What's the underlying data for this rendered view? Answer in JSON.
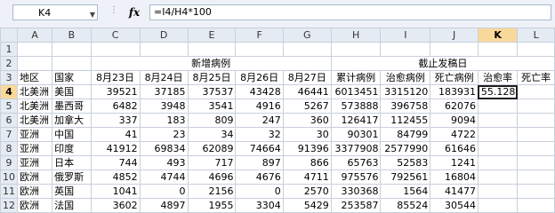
{
  "formula_bar": {
    "name_box": "K4",
    "fx_label": "fx",
    "formula": "=I4/H4*100"
  },
  "columns": [
    "A",
    "B",
    "C",
    "D",
    "E",
    "F",
    "G",
    "H",
    "I",
    "J",
    "K",
    "L"
  ],
  "rows": [
    "1",
    "2",
    "3",
    "4",
    "5",
    "6",
    "7",
    "8",
    "9",
    "10",
    "11",
    "12"
  ],
  "headers": {
    "new_cases": "新增病例",
    "as_of": "截止发稿日",
    "region": "地区",
    "country": "国家",
    "dates": [
      "8月23日",
      "8月24日",
      "8月25日",
      "8月26日",
      "8月27日"
    ],
    "cumulative": "累计病例",
    "recovered": "治愈病例",
    "deaths": "死亡病例",
    "recovery_rate": "治愈率",
    "death_rate": "死亡率"
  },
  "data_rows": [
    {
      "region": "北美洲",
      "country": "美国",
      "d": [
        "39521",
        "37185",
        "37537",
        "43428",
        "46441"
      ],
      "cum": "6013451",
      "rec": "3315120",
      "dead": "183931",
      "rate": "55.128"
    },
    {
      "region": "北美洲",
      "country": "墨西哥",
      "d": [
        "6482",
        "3948",
        "3541",
        "4916",
        "5267"
      ],
      "cum": "573888",
      "rec": "396758",
      "dead": "62076",
      "rate": ""
    },
    {
      "region": "北美洲",
      "country": "加拿大",
      "d": [
        "337",
        "183",
        "809",
        "247",
        "360"
      ],
      "cum": "126417",
      "rec": "112455",
      "dead": "9094",
      "rate": ""
    },
    {
      "region": "亚洲",
      "country": "中国",
      "d": [
        "41",
        "23",
        "34",
        "32",
        "30"
      ],
      "cum": "90301",
      "rec": "84799",
      "dead": "4722",
      "rate": ""
    },
    {
      "region": "亚洲",
      "country": "印度",
      "d": [
        "41912",
        "69834",
        "62089",
        "74664",
        "91396"
      ],
      "cum": "3377908",
      "rec": "2577990",
      "dead": "61646",
      "rate": ""
    },
    {
      "region": "亚洲",
      "country": "日本",
      "d": [
        "744",
        "493",
        "717",
        "897",
        "866"
      ],
      "cum": "65763",
      "rec": "52583",
      "dead": "1241",
      "rate": ""
    },
    {
      "region": "欧洲",
      "country": "俄罗斯",
      "d": [
        "4852",
        "4744",
        "4696",
        "4676",
        "4711"
      ],
      "cum": "975576",
      "rec": "792561",
      "dead": "16804",
      "rate": ""
    },
    {
      "region": "欧洲",
      "country": "英国",
      "d": [
        "1041",
        "0",
        "2156",
        "0",
        "2570"
      ],
      "cum": "330368",
      "rec": "1564",
      "dead": "41477",
      "rate": ""
    },
    {
      "region": "欧洲",
      "country": "法国",
      "d": [
        "3602",
        "4897",
        "1955",
        "3304",
        "5429"
      ],
      "cum": "253587",
      "rec": "85524",
      "dead": "30544",
      "rate": ""
    }
  ]
}
